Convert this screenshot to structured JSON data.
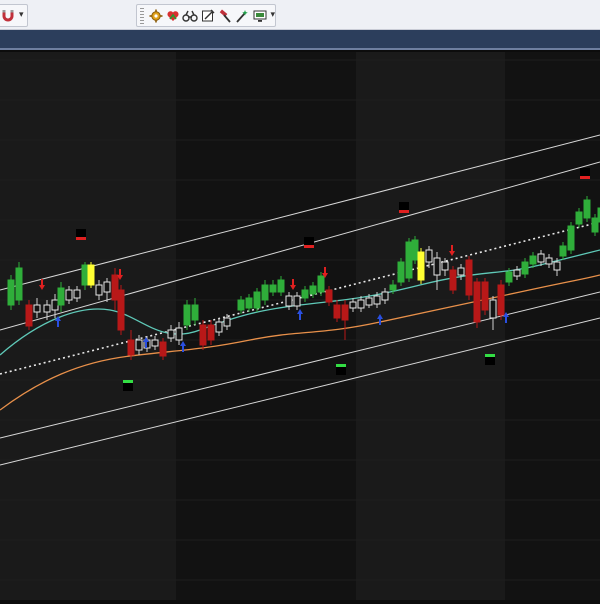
{
  "toolbar": {
    "left_group_icons": [
      "magnet-icon"
    ],
    "main_group_icons": [
      "gear-icon",
      "heart-icon",
      "binoculars-icon",
      "draw-icon",
      "hammer-icon",
      "wand-icon",
      "monitor-icon"
    ]
  },
  "colors": {
    "up_candle": "#2fae3a",
    "down_candle": "#b81818",
    "highlight_candle": "#ffff33",
    "neutral_candle": "#e0e0e0",
    "ma_fast": "#5fc9b8",
    "ma_slow": "#e8904a",
    "channel": "#d8d8d8",
    "sell_arrow": "#e02020",
    "buy_arrow": "#2a4fe0",
    "grid": "#1e1e1e"
  },
  "chart_data": {
    "type": "candlestick",
    "bands": [
      {
        "shade": "light"
      },
      {
        "shade": "dark"
      },
      {
        "shade": "light"
      },
      {
        "shade": "dark"
      }
    ]
  }
}
